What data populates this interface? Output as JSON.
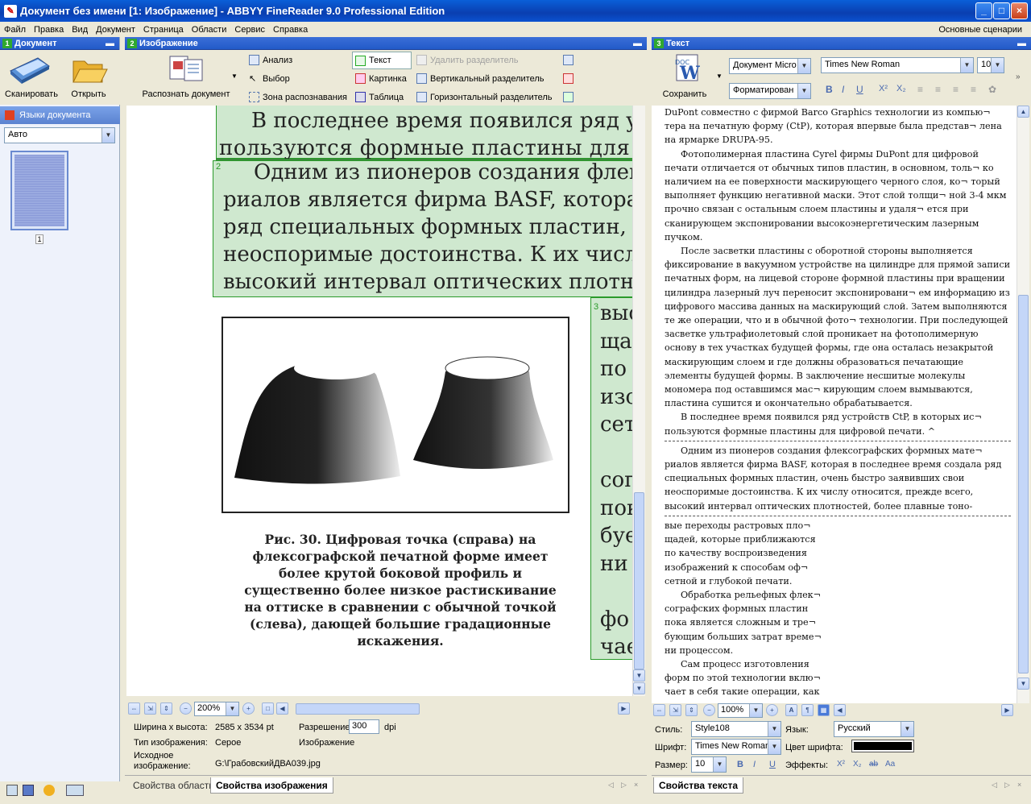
{
  "window": {
    "title": "Документ без имени [1: Изображение] - ABBYY FineReader 9.0 Professional Edition",
    "minimize": "_",
    "maximize": "□",
    "close": "×"
  },
  "menu": {
    "items": [
      "Файл",
      "Правка",
      "Вид",
      "Документ",
      "Страница",
      "Области",
      "Сервис",
      "Справка"
    ],
    "right": "Основные сценарии"
  },
  "doc_panel": {
    "num": "1",
    "title": "Документ",
    "scan_label": "Сканировать",
    "open_label": "Открыть",
    "lang_header": "Языки документа",
    "lang_value": "Авто",
    "page_number": "1"
  },
  "image_panel": {
    "num": "2",
    "title": "Изображение",
    "recognize_label": "Распознать документ",
    "tools": {
      "analyze": "Анализ",
      "select": "Выбор",
      "recog_zone": "Зона распознавания",
      "text": "Текст",
      "picture": "Картинка",
      "table": "Таблица",
      "delete_sep": "Удалить разделитель",
      "vert_sep": "Вертикальный разделитель",
      "horiz_sep": "Горизонтальный разделитель"
    },
    "zoom": "200%",
    "scan": {
      "line1": "В последнее время появился ряд ус",
      "line2": "пользуются  формные  пластины  для",
      "block2_num": "2",
      "b2": [
        "Одним из пионеров создания флек",
        "риалов является фирма BASF, котора",
        "ряд специальных формных пластин, о",
        "неоспоримые достоинства. К их числ",
        "высокий интервал оптических плотн"
      ],
      "block3_num": "3",
      "b3": [
        "выс",
        "щад",
        "по",
        "изо",
        "сет",
        "",
        "сог",
        "пок",
        "буе",
        "ни",
        "",
        "фо",
        "чае"
      ],
      "caption": [
        "Рис. 30. Цифровая точка (справа) на",
        "флексографской печатной форме имеет",
        "более крутой боковой профиль и",
        "существенно более низкое растискивание",
        "на оттиске в сравнении с обычной точкой",
        "(слева), дающей большие градационные",
        "искажения."
      ]
    },
    "props": {
      "size_label": "Ширина x высота:",
      "size_value": "2585 x 3534 pt",
      "type_label": "Тип изображения:",
      "type_value": "Серое",
      "res_label": "Разрешение:",
      "res_value": "300",
      "res_unit": "dpi",
      "image_label": "Изображение",
      "src_label": "Исходное изображение:",
      "src_value": "G:\\ГрабовскийДВА039.jpg"
    },
    "tabs": [
      "Свойства области",
      "Свойства изображения"
    ]
  },
  "text_panel": {
    "num": "3",
    "title": "Текст",
    "save_label": "Сохранить",
    "doc_mode": "Документ Micro",
    "format_mode": "Форматирован",
    "font": "Times New Roman",
    "font_size": "10",
    "format_btns": {
      "bold": "B",
      "italic": "I",
      "underline": "U",
      "sup": "X²",
      "sub": "X₂"
    },
    "zoom": "100%",
    "paragraphs": [
      "DuPont совместно с фирмой Barco Graphics технологии из компью¬ тера на печатную форму (CtP), которая впервые была представ¬ лена на ярмарке DRUPA-95.",
      "Фотополимерная пластина Cyrel фирмы DuPont для цифровой печати отличается от обычных типов пластин, в основном, толь¬ ко наличием на ее поверхности маскирующего черного слоя, ко¬ торый выполняет функцию негативной маски. Этот слой толщи¬ ной 3-4 мкм прочно связан с остальным слоем пластины и удаля¬ ется при сканирующем экспонировании высокоэнергетическим лазерным пучком.",
      "После засветки пластины с оборотной стороны выполняется фиксирование в вакуумном устройстве на цилиндре для прямой записи печатных форм, на лицевой стороне формной пластины при вращении цилиндра лазерный луч переносит экспонировани¬ ем информацию из цифрового массива данных на маскирующий слой. Затем выполняются те же операции, что и в обычной фото¬ технологии. При последующей засветке ультрафиолетовый слой проникает на фотополимерную основу в тех участках будущей формы, где она осталась незакрытой маскирующим слоем и где должны образоваться печатающие элементы будущей формы. В заключение несшитые молекулы мономера под оставшимся мас¬ кирующим слоем вымываются, пластина сушится и окончательно обрабатывается.",
      "В последнее время появился ряд устройств CtP, в которых ис¬ пользуются формные пластины для цифровой печати.  ^",
      "Одним из пионеров создания флексографских формных мате¬ риалов является фирма BASF, которая в последнее время создала ряд специальных формных пластин, очень быстро заявивших свои неоспоримые достоинства. К их числу относится, прежде всего, высокий интервал оптических плотностей, более плавные тоно-",
      "вые переходы растровых пло¬ щадей, которые приближаются по качеству воспроизведения изображений к способам оф¬ сетной и глубокой печати.",
      "Обработка рельефных флек¬ сографских формных пластин пока является сложным и тре¬ бующим больших затрат време¬ ни процессом.",
      "Сам процесс изготовления форм по этой технологии вклю¬ чает в себя такие операции, как"
    ],
    "props": {
      "style_label": "Стиль:",
      "style_value": "Style108",
      "lang_label": "Язык:",
      "lang_value": "Русский",
      "font_label": "Шрифт:",
      "font_value": "Times New Roman",
      "color_label": "Цвет шрифта:",
      "size_label": "Размер:",
      "size_value": "10",
      "effects_label": "Эффекты:"
    },
    "tab": "Свойства текста"
  }
}
